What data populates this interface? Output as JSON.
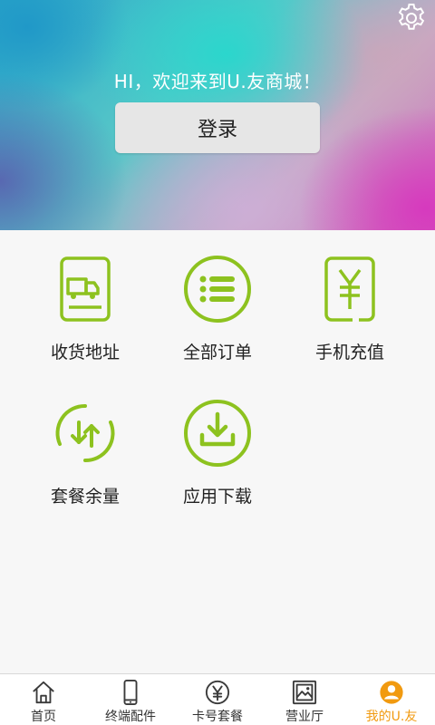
{
  "header": {
    "welcome_text": "HI，欢迎来到U.友商城！",
    "login_label": "登录",
    "settings_icon": "gear-icon"
  },
  "menu": {
    "accent_color": "#8dc21f",
    "items": [
      {
        "label": "收货地址",
        "icon": "truck-icon"
      },
      {
        "label": "全部订单",
        "icon": "list-icon"
      },
      {
        "label": "手机充值",
        "icon": "yen-icon"
      },
      {
        "label": "套餐余量",
        "icon": "data-usage-icon"
      },
      {
        "label": "应用下载",
        "icon": "download-icon"
      }
    ]
  },
  "tabbar": {
    "active_color": "#f19a10",
    "items": [
      {
        "label": "首页",
        "icon": "home-icon"
      },
      {
        "label": "终端配件",
        "icon": "phone-icon"
      },
      {
        "label": "卡号套餐",
        "icon": "yen-circle-icon"
      },
      {
        "label": "营业厅",
        "icon": "picture-icon"
      },
      {
        "label": "我的U.友",
        "icon": "user-icon",
        "active": true
      }
    ]
  }
}
